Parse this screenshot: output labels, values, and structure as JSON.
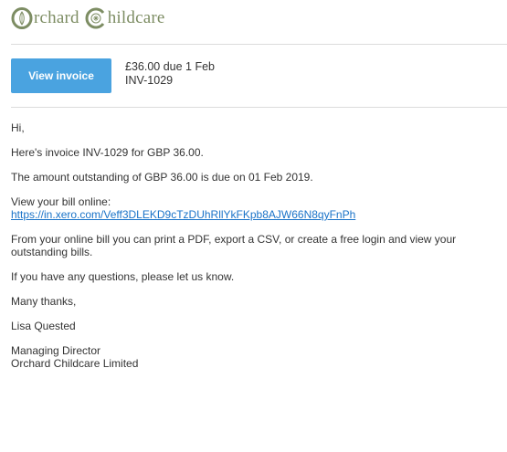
{
  "brand": {
    "name_part1": "rchard",
    "name_part2": "hildcare",
    "accent": "#7d8d63"
  },
  "invoice_summary": {
    "button_label": "View invoice",
    "amount_due": "£36.00 due 1 Feb",
    "number": "INV-1029",
    "button_color": "#4aa3e0"
  },
  "email": {
    "greeting": "Hi,",
    "line1": "Here's invoice INV-1029 for GBP 36.00.",
    "line2": "The amount outstanding of GBP 36.00 is due on 01 Feb 2019.",
    "view_online_label": "View your bill online:",
    "bill_link": "https://in.xero.com/Veff3DLEKD9cTzDUhRllYkFKpb8AJW66N8qyFnPh",
    "line3": "From your online bill you can print a PDF, export a CSV, or create a free login and view your outstanding bills.",
    "line4": "If you have any questions, please let us know.",
    "signoff": "Many thanks,",
    "sender_name": "Lisa Quested",
    "sender_title": "Managing Director",
    "sender_company": "Orchard Childcare Limited",
    "link_color": "#1a73c8"
  }
}
